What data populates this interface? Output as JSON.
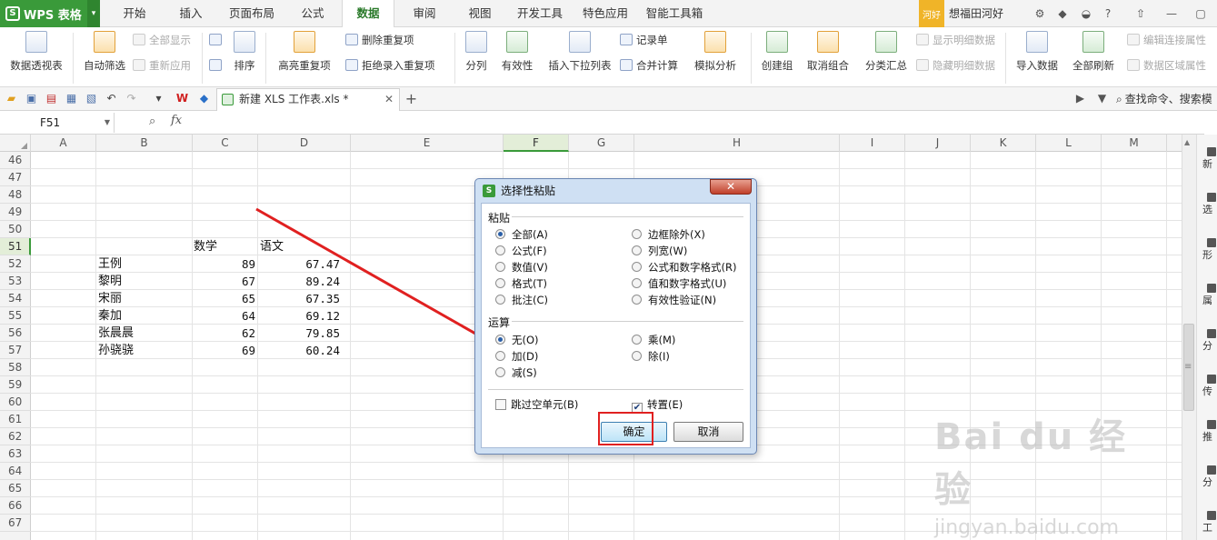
{
  "app": {
    "name": "WPS 表格"
  },
  "menu": {
    "tabs": [
      "开始",
      "插入",
      "页面布局",
      "公式",
      "数据",
      "审阅",
      "视图",
      "开发工具",
      "特色应用",
      "智能工具箱"
    ],
    "active": "数据"
  },
  "user": {
    "badge": "河好",
    "name": "想福田河好"
  },
  "ribbon": {
    "pivot": "数据透视表",
    "autofilter": "自动筛选",
    "show_all": "全部显示",
    "reapply": "重新应用",
    "sort": "排序",
    "highlight_dup": "高亮重复项",
    "delete_dup": "删除重复项",
    "reject_dup": "拒绝录入重复项",
    "split": "分列",
    "validity": "有效性",
    "insert_dropdown": "插入下拉列表",
    "record": "记录单",
    "consolidate": "合并计算",
    "simulate": "模拟分析",
    "create_group": "创建组",
    "ungroup": "取消组合",
    "subtotal": "分类汇总",
    "show_detail": "显示明细数据",
    "hide_detail": "隐藏明细数据",
    "import": "导入数据",
    "refresh_all": "全部刷新",
    "edit_conn": "编辑连接属性",
    "data_region": "数据区域属性"
  },
  "doctab": {
    "title": "新建 XLS 工作表.xls *"
  },
  "search": {
    "label": "查找命令、搜索模"
  },
  "formula": {
    "namebox": "F51",
    "fx": "fx"
  },
  "columns": [
    "A",
    "B",
    "C",
    "D",
    "E",
    "F",
    "G",
    "H",
    "I",
    "J",
    "K",
    "L",
    "M"
  ],
  "rows": [
    "46",
    "47",
    "48",
    "49",
    "50",
    "51",
    "52",
    "53",
    "54",
    "55",
    "56",
    "57",
    "58",
    "59",
    "60",
    "61",
    "62",
    "63",
    "64",
    "65",
    "66",
    "67"
  ],
  "table": {
    "headers": {
      "c": "数学",
      "d": "语文"
    },
    "records": [
      {
        "name": "王例",
        "math": "89",
        "chinese": "67.47"
      },
      {
        "name": "黎明",
        "math": "67",
        "chinese": "89.24"
      },
      {
        "name": "宋丽",
        "math": "65",
        "chinese": "67.35"
      },
      {
        "name": "秦加",
        "math": "64",
        "chinese": "69.12"
      },
      {
        "name": "张晨晨",
        "math": "62",
        "chinese": "79.85"
      },
      {
        "name": "孙骁骁",
        "math": "69",
        "chinese": "60.24"
      }
    ]
  },
  "sidepanel": [
    "新",
    "选",
    "形",
    "属",
    "分",
    "传",
    "推",
    "分",
    "工"
  ],
  "dialog": {
    "title": "选择性粘贴",
    "close": "✕",
    "paste_group": "粘贴",
    "paste_left": [
      "全部(A)",
      "公式(F)",
      "数值(V)",
      "格式(T)",
      "批注(C)"
    ],
    "paste_right": [
      "边框除外(X)",
      "列宽(W)",
      "公式和数字格式(R)",
      "值和数字格式(U)",
      "有效性验证(N)"
    ],
    "op_group": "运算",
    "op_left": [
      "无(O)",
      "加(D)",
      "减(S)"
    ],
    "op_right": [
      "乘(M)",
      "除(I)"
    ],
    "skip_blanks": "跳过空单元(B)",
    "transpose": "转置(E)",
    "ok": "确定",
    "cancel": "取消"
  },
  "watermark": {
    "brand": "Bai du 经验",
    "url": "jingyan.baidu.com"
  },
  "colors": {
    "accent": "#3a9a3a",
    "annotation": "#e02020"
  }
}
